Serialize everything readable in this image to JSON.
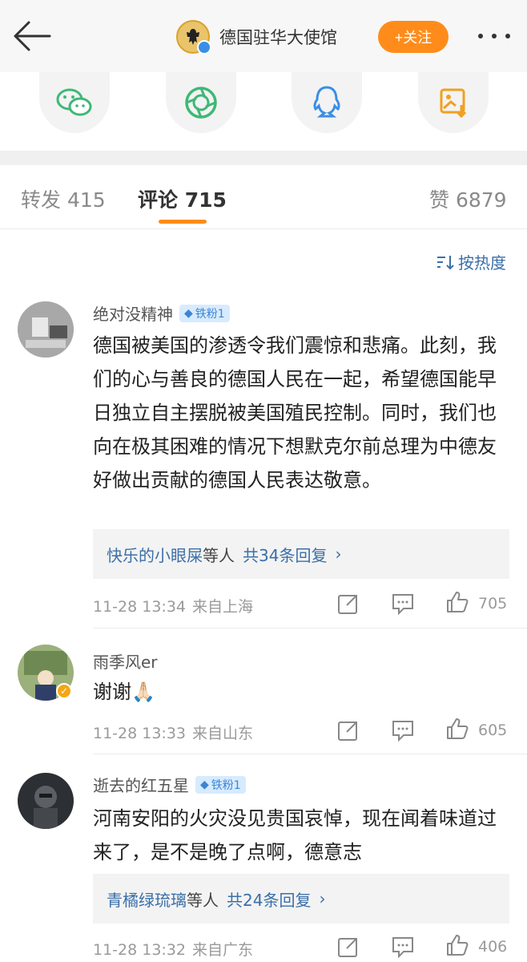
{
  "header": {
    "account_name": "德国驻华大使馆",
    "follow_label": "+关注",
    "icons": [
      "back-arrow-icon",
      "emblem-avatar",
      "verified-icon",
      "more-icon"
    ]
  },
  "share": {
    "icons": [
      "wechat-icon",
      "moments-icon",
      "qq-icon",
      "save-image-icon"
    ]
  },
  "tabs": [
    {
      "label": "转发",
      "count": "415"
    },
    {
      "label": "评论",
      "count": "715"
    },
    {
      "label": "赞",
      "count": "6879"
    }
  ],
  "sort_label": "按热度",
  "colors": {
    "accent": "#ff8c1a",
    "link": "#3b6fa8",
    "badge_bg": "#d7ebff"
  },
  "comments": [
    {
      "username": "绝对没精神",
      "badge": "铁粉1",
      "text": "德国被美国的渗透令我们震惊和悲痛。此刻，我们的心与善良的德国人民在一起，希望德国能早日独立自主摆脱被美国殖民控制。同时，我们也向在极其困难的情况下想默克尔前总理为中德友好做出贡献的德国人民表达敬意。",
      "reply_user": "快乐的小眼屎",
      "reply_mid": "等人",
      "reply_count": "共34条回复",
      "time": "11-28 13:34",
      "location": "来自上海",
      "likes": "705"
    },
    {
      "username": "雨季风er",
      "text": "谢谢🙏🏻",
      "time": "11-28 13:33",
      "location": "来自山东",
      "likes": "605"
    },
    {
      "username": "逝去的红五星",
      "badge": "铁粉1",
      "text": "河南安阳的火灾没见贵国哀悼，现在闻着味道过来了，是不是晚了点啊，德意志",
      "reply_user": "青橘绿琉璃",
      "reply_mid": "等人",
      "reply_count": "共24条回复",
      "time": "11-28 13:32",
      "location": "来自广东",
      "likes": "406"
    }
  ]
}
